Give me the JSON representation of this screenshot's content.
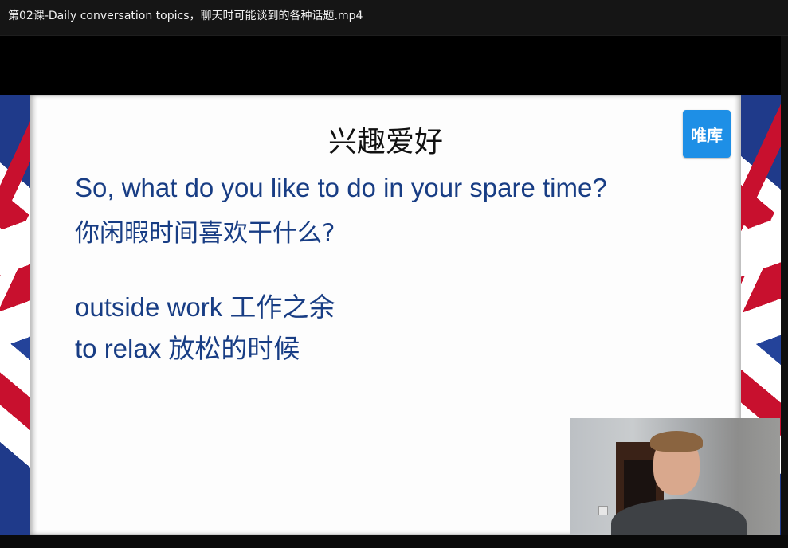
{
  "window": {
    "title": "第02课-Daily conversation topics，聊天时可能谈到的各种话题.mp4"
  },
  "slide": {
    "title": "兴趣爱好",
    "logo_text": "唯库",
    "lines": [
      "So, what do you like to do in your spare time?",
      "你闲暇时间喜欢干什么?",
      "outside work 工作之余",
      "to relax 放松的时候"
    ]
  },
  "colors": {
    "text_blue": "#183d84",
    "logo_blue": "#1e8fe6"
  }
}
